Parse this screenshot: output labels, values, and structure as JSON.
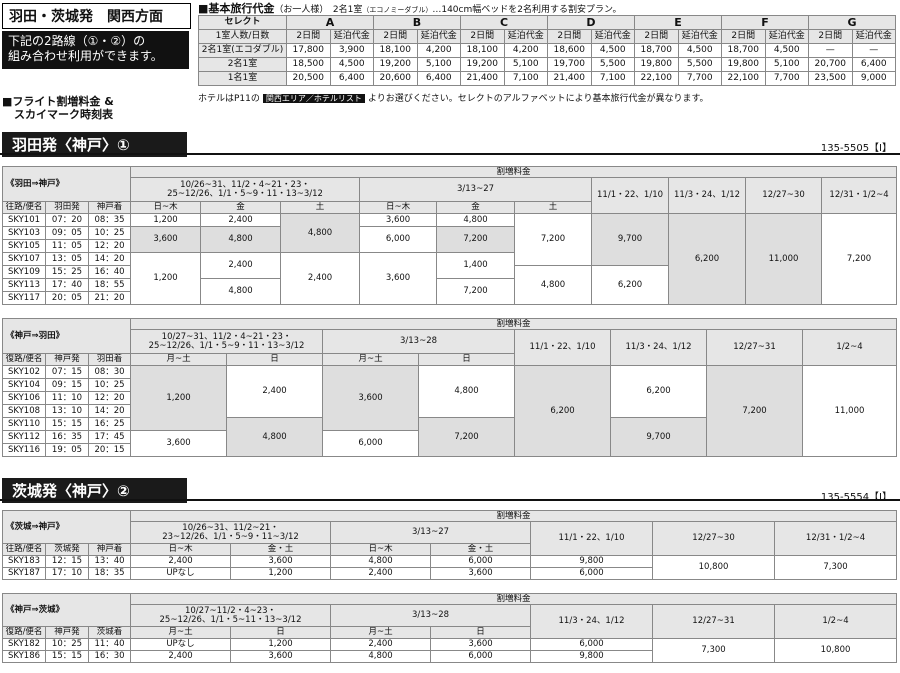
{
  "header": {
    "title": "羽田・茨城発　関西方面",
    "notice": "下記の2路線（①・②）の組み合わせ利用ができます。",
    "notice_line1": "下記の2路線（①・②）の",
    "notice_line2": "組み合わせ利用ができます。"
  },
  "price_table": {
    "title": "■基本旅行代金",
    "title_note": "（お一人様）　2名1室",
    "title_note2": "（エコノミーダブル）",
    "title_note3": "…140cm幅ベッドを2名利用する割安プラン。",
    "select_label": "セレクト",
    "rooms_label": "1室人数/日数",
    "grades": [
      "A",
      "B",
      "C",
      "D",
      "E",
      "F",
      "G"
    ],
    "sub": [
      "2日間",
      "延泊代金"
    ],
    "rows": [
      {
        "label": "2名1室(エコダブル)",
        "values": [
          "17,800",
          "3,900",
          "18,100",
          "4,200",
          "18,100",
          "4,200",
          "18,600",
          "4,500",
          "18,700",
          "4,500",
          "18,700",
          "4,500",
          "—",
          "—"
        ]
      },
      {
        "label": "2名1室",
        "values": [
          "18,500",
          "4,500",
          "19,200",
          "5,100",
          "19,200",
          "5,100",
          "19,700",
          "5,500",
          "19,800",
          "5,500",
          "19,800",
          "5,100",
          "20,700",
          "6,400"
        ]
      },
      {
        "label": "1名1室",
        "values": [
          "20,500",
          "6,400",
          "20,600",
          "6,400",
          "21,400",
          "7,100",
          "21,400",
          "7,100",
          "22,100",
          "7,700",
          "22,100",
          "7,700",
          "23,500",
          "9,000"
        ]
      }
    ],
    "hotel_note_pre": "ホテルはP11の",
    "hotel_note_tag": "関西エリア／ホテルリスト",
    "hotel_note_post": "よりお選びください。セレクトのアルファベットにより基本旅行代金が異なります。"
  },
  "flight_section": {
    "title_line1": "■フライト割増料金 &",
    "title_line2": "スカイマーク時刻表"
  },
  "route1": {
    "title": "羽田発〈神戸〉①",
    "code": "135-5505【Ⅰ】",
    "outbound": {
      "label": "《羽田⇒神戸》",
      "surcharge": "割増料金",
      "cols": [
        "往路/便名",
        "羽田発",
        "神戸着"
      ],
      "period1": "10/26~31、11/2・4~21・23・",
      "period1b": "25~12/26、1/1・5~9・11・13~3/12",
      "period2": "3/13~27",
      "period3": "11/1・22、1/10",
      "period4": "11/3・24、1/12",
      "period5": "12/27~30",
      "period6": "12/31・1/2~4",
      "days": [
        "日~木",
        "金",
        "土",
        "日~木",
        "金",
        "土"
      ],
      "flights": [
        [
          "SKY101",
          "07：20",
          "08：35"
        ],
        [
          "SKY103",
          "09：05",
          "10：25"
        ],
        [
          "SKY105",
          "11：05",
          "12：20"
        ],
        [
          "SKY107",
          "13：05",
          "14：20"
        ],
        [
          "SKY109",
          "15：25",
          "16：40"
        ],
        [
          "SKY113",
          "17：40",
          "18：55"
        ],
        [
          "SKY117",
          "20：05",
          "21：20"
        ]
      ],
      "p": {
        "a": "1,200",
        "b": "2,400",
        "c": "4,800",
        "d": "3,600",
        "e": "4,800",
        "f": "3,600",
        "g": "4,800",
        "h": "6,000",
        "i": "7,200",
        "j": "7,200",
        "k": "9,700",
        "l": "6,200",
        "m": "11,000",
        "n": "7,200",
        "o": "1,200",
        "p": "2,400",
        "q": "2,400",
        "r": "3,600",
        "s": "1,400",
        "t": "4,800",
        "u": "4,800",
        "v": "7,200",
        "w": "6,200"
      }
    },
    "inbound": {
      "label": "《神戸⇒羽田》",
      "surcharge": "割増料金",
      "cols": [
        "復路/便名",
        "神戸発",
        "羽田着"
      ],
      "period1": "10/27~31、11/2・4~21・23・",
      "period1b": "25~12/26、1/1・5~9・11・13~3/12",
      "period2": "3/13~28",
      "period3": "11/1・22、1/10",
      "period4": "11/3・24、1/12",
      "period5": "12/27~31",
      "period6": "1/2~4",
      "days": [
        "月~土",
        "日",
        "月~土",
        "日"
      ],
      "flights": [
        [
          "SKY102",
          "07：15",
          "08：30"
        ],
        [
          "SKY104",
          "09：15",
          "10：25"
        ],
        [
          "SKY106",
          "11：10",
          "12：20"
        ],
        [
          "SKY108",
          "13：10",
          "14：20"
        ],
        [
          "SKY110",
          "15：15",
          "16：25"
        ],
        [
          "SKY112",
          "16：35",
          "17：45"
        ],
        [
          "SKY116",
          "19：05",
          "20：15"
        ]
      ],
      "p": {
        "a": "1,200",
        "b": "2,400",
        "c": "3,600",
        "d": "4,800",
        "e": "6,200",
        "f": "6,200",
        "g": "7,200",
        "h": "11,000",
        "i": "3,600",
        "j": "4,800",
        "k": "6,000",
        "l": "7,200",
        "m": "9,700"
      }
    }
  },
  "route2": {
    "title": "茨城発〈神戸〉②",
    "code": "135-5554【Ⅰ】",
    "outbound": {
      "label": "《茨城⇒神戸》",
      "surcharge": "割増料金",
      "cols": [
        "往路/便名",
        "茨城発",
        "神戸着"
      ],
      "period1": "10/26~31、11/2~21・",
      "period1b": "23~12/26、1/1・5~9・11~3/12",
      "period2": "3/13~27",
      "period3": "11/1・22、1/10",
      "period4": "12/27~30",
      "period5": "12/31・1/2~4",
      "days": [
        "日~木",
        "金・土",
        "日~木",
        "金・土"
      ],
      "flights": [
        [
          "SKY183",
          "12：15",
          "13：40",
          "2,400",
          "3,600",
          "4,800",
          "6,000",
          "9,800"
        ],
        [
          "SKY187",
          "17：10",
          "18：35",
          "UPなし",
          "1,200",
          "2,400",
          "3,600",
          "6,000"
        ]
      ],
      "p": {
        "a": "10,800",
        "b": "7,300"
      }
    },
    "inbound": {
      "label": "《神戸⇒茨城》",
      "surcharge": "割増料金",
      "cols": [
        "復路/便名",
        "神戸発",
        "茨城着"
      ],
      "period1": "10/27~11/2・4~23・",
      "period1b": "25~12/26、1/1・5~11・13~3/12",
      "period2": "3/13~28",
      "period3": "11/3・24、1/12",
      "period4": "12/27~31",
      "period5": "1/2~4",
      "days": [
        "月~土",
        "日",
        "月~土",
        "日"
      ],
      "flights": [
        [
          "SKY182",
          "10：25",
          "11：40",
          "UPなし",
          "1,200",
          "2,400",
          "3,600",
          "6,000"
        ],
        [
          "SKY186",
          "15：15",
          "16：30",
          "2,400",
          "3,600",
          "4,800",
          "6,000",
          "9,800"
        ]
      ],
      "p": {
        "a": "7,300",
        "b": "10,800"
      }
    }
  }
}
